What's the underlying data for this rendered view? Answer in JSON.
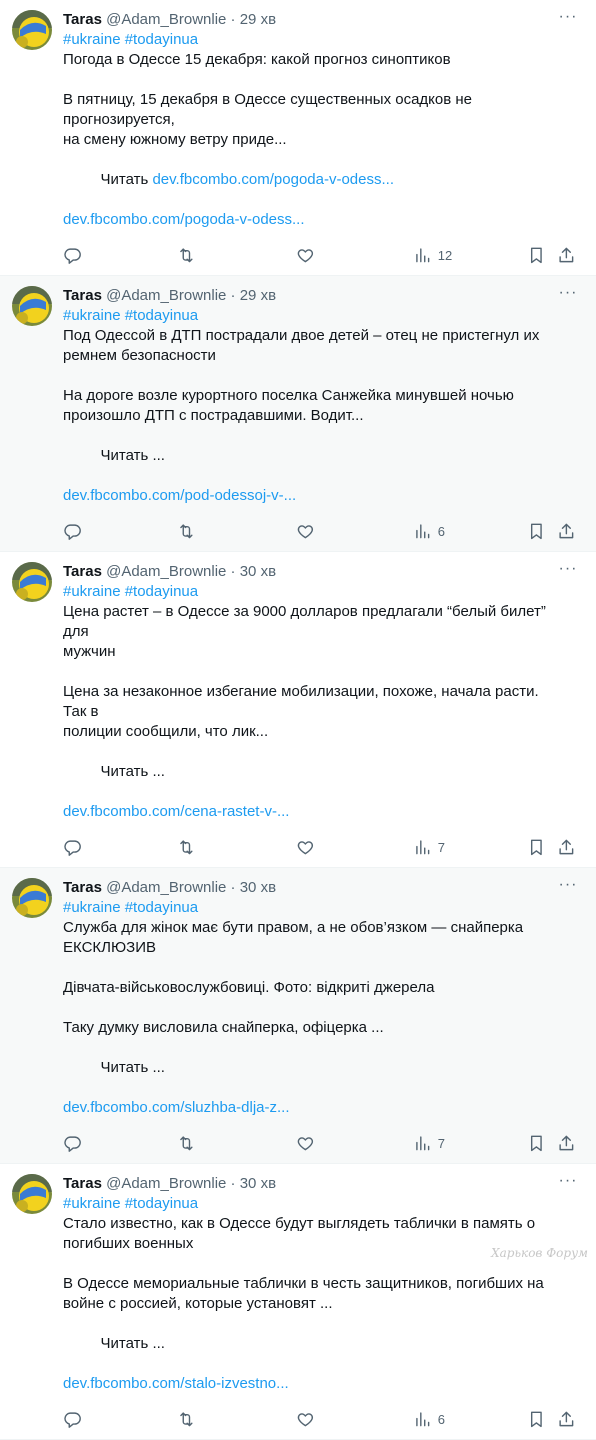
{
  "tweets": [
    {
      "name": "Taras",
      "handle": "@Adam_Brownlie",
      "time": "29 хв",
      "tags": "#ukraine #todayinua",
      "lines": [
        "Погода в Одессе 15 декабря: какой прогноз синоптиков",
        "",
        "В пятницу, 15 декабря в Одессе существенных осадков не прогнозируется,",
        "на смену южному ветру приде..."
      ],
      "read_label": " Читать ",
      "read_link": "dev.fbcombo.com/pogoda-v-odess...",
      "link": "dev.fbcombo.com/pogoda-v-odess...",
      "views": "12"
    },
    {
      "name": "Taras",
      "handle": "@Adam_Brownlie",
      "time": "29 хв",
      "tags": "#ukraine #todayinua",
      "lines": [
        "Под Одессой в ДТП пострадали двое детей – отец не пристегнул их",
        "ремнем безопасности",
        "",
        "На дороге возле курортного поселка Санжейка минувшей ночью",
        "произошло ДТП с пострадавшими. Водит..."
      ],
      "read_label": " Читать ...",
      "read_link": "",
      "link": "dev.fbcombo.com/pod-odessoj-v-...",
      "views": "6"
    },
    {
      "name": "Taras",
      "handle": "@Adam_Brownlie",
      "time": "30 хв",
      "tags": "#ukraine #todayinua",
      "lines": [
        "Цена растет – в Одессе за 9000 долларов предлагали “белый билет” для",
        "мужчин",
        "",
        "Цена за незаконное избегание мобилизации, похоже, начала расти. Так в",
        "полиции сообщили, что лик..."
      ],
      "read_label": " Читать ...",
      "read_link": "",
      "link": "dev.fbcombo.com/cena-rastet-v-...",
      "views": "7"
    },
    {
      "name": "Taras",
      "handle": "@Adam_Brownlie",
      "time": "30 хв",
      "tags": "#ukraine #todayinua",
      "lines": [
        "Служба для жінок має бути правом, а не обов’язком — снайперка",
        "ЕКСКЛЮЗИВ",
        "",
        "Дівчата-військовослужбовиці. Фото: відкриті джерела",
        "",
        "Таку думку висловила снайперка, офіцерка ..."
      ],
      "read_label": " Читать ...",
      "read_link": "",
      "link": "dev.fbcombo.com/sluzhba-dlja-z...",
      "views": "7"
    },
    {
      "name": "Taras",
      "handle": "@Adam_Brownlie",
      "time": "30 хв",
      "tags": "#ukraine #todayinua",
      "lines": [
        "Стало известно, как в Одессе будут выглядеть таблички в память о",
        "погибших военных",
        "",
        "В Одессе мемориальные таблички в честь защитников, погибших на",
        "войне с россией, которые установят ..."
      ],
      "read_label": " Читать ...",
      "read_link": "",
      "link": "dev.fbcombo.com/stalo-izvestno...",
      "views": "6"
    }
  ],
  "separator": "·",
  "more_glyph": "···",
  "watermark": "Харьков Форум",
  "icons": [
    "reply-icon",
    "retweet-icon",
    "like-icon",
    "views-icon",
    "bookmark-icon",
    "share-icon",
    "more-icon"
  ],
  "colors": {
    "link": "#1d9bf0",
    "muted": "#536471",
    "text": "#0f1419",
    "alt_bg": "#f7f9f9"
  }
}
